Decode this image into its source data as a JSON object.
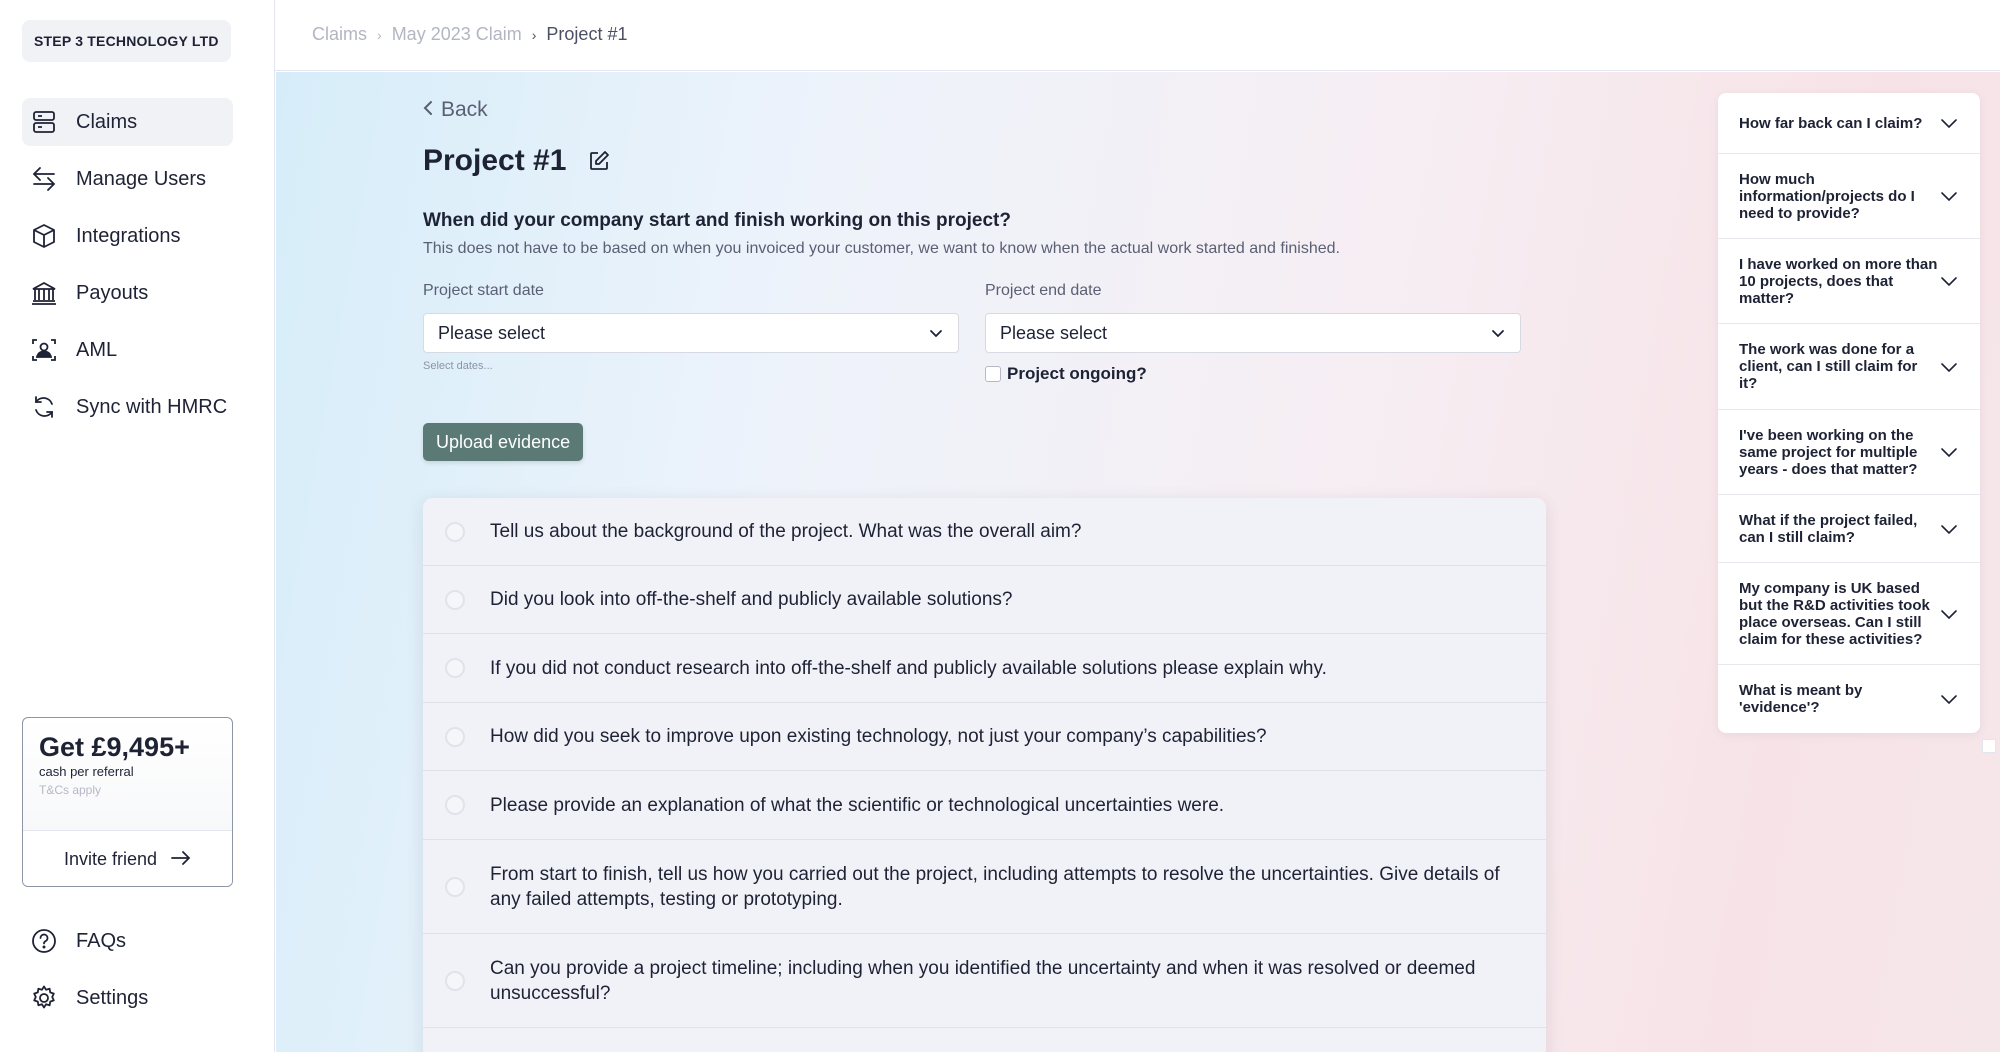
{
  "sidebar": {
    "company": "STEP 3 TECHNOLOGY LTD",
    "nav": [
      {
        "label": "Claims",
        "icon": "claims-icon",
        "active": true
      },
      {
        "label": "Manage Users",
        "icon": "swap-arrows-icon"
      },
      {
        "label": "Integrations",
        "icon": "cube-icon"
      },
      {
        "label": "Payouts",
        "icon": "bank-icon"
      },
      {
        "label": "AML",
        "icon": "id-badge-icon"
      },
      {
        "label": "Sync with HMRC",
        "icon": "sync-icon"
      }
    ],
    "referral": {
      "title": "Get £9,495+",
      "subtitle": "cash per referral",
      "terms": "T&Cs apply",
      "button": "Invite friend"
    },
    "bottom": [
      {
        "label": "FAQs",
        "icon": "help-circle-icon"
      },
      {
        "label": "Settings",
        "icon": "gear-icon"
      }
    ]
  },
  "breadcrumb": [
    "Claims",
    "May 2023 Claim",
    "Project #1"
  ],
  "main": {
    "back": "Back",
    "title": "Project #1",
    "question": "When did your company start and finish working on this project?",
    "description": "This does not have to be based on when you invoiced your customer, we want to know when the actual work started and finished.",
    "start_label": "Project start date",
    "start_value": "Please select",
    "end_label": "Project end date",
    "end_value": "Please select",
    "hint": "Select dates...",
    "ongoing": "Project ongoing?",
    "upload": "Upload evidence",
    "questions": [
      "Tell us about the background of the project. What was the overall aim?",
      "Did you look into off-the-shelf and publicly available solutions?",
      "If you did not conduct research into off-the-shelf and publicly available solutions please explain why.",
      "How did you seek to improve upon existing technology, not just your company’s capabilities?",
      "Please provide an explanation of what the scientific or technological uncertainties were.",
      "From start to finish, tell us how you carried out the project, including attempts to resolve the uncertainties. Give details of any failed attempts, testing or prototyping.",
      "Can you provide a project timeline; including when you identified the uncertainty and when it was resolved or deemed unsuccessful?"
    ]
  },
  "faq": [
    "How far back can I claim?",
    "How much information/projects do I need to provide?",
    "I have worked on more than 10 projects, does that matter?",
    "The work was done for a client, can I still claim for it?",
    "I've been working on the same project for multiple years - does that matter?",
    "What if the project failed, can I still claim?",
    "My company is UK based but the R&D activities took place overseas. Can I still claim for these activities?",
    "What is meant by 'evidence'?"
  ]
}
